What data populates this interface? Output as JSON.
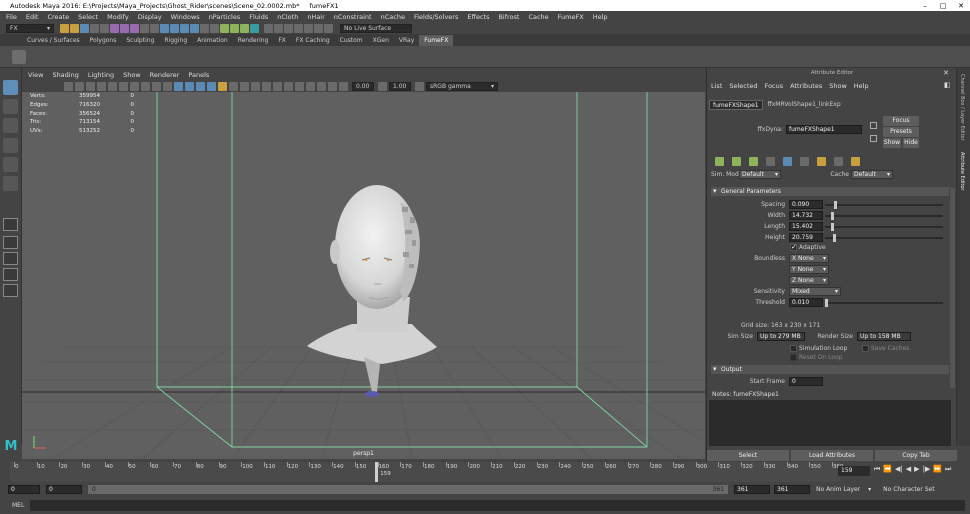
{
  "window": {
    "title": "Autodesk Maya 2016: E:\\Projects\\Maya_Projects\\Ghost_Rider\\scenes\\Scene_02.0002.mb*",
    "object": "fumeFX1",
    "controls": [
      "–",
      "□",
      "✕"
    ]
  },
  "menubar": [
    "File",
    "Edit",
    "Create",
    "Select",
    "Modify",
    "Display",
    "Windows",
    "nParticles",
    "Fluids",
    "nCloth",
    "nHair",
    "nConstraint",
    "nCache",
    "Fields/Solvers",
    "Effects",
    "Bifrost",
    "Cache",
    "FumeFX",
    "Help"
  ],
  "statusline": {
    "menuset": "FX",
    "live_surface": "No Live Surface"
  },
  "shelf_tabs": [
    "Curves / Surfaces",
    "Polygons",
    "Sculpting",
    "Rigging",
    "Animation",
    "Rendering",
    "FX",
    "FX Caching",
    "Custom",
    "XGen",
    "VRay",
    "FumeFX"
  ],
  "shelf_selected": "FumeFX",
  "viewport": {
    "menu": [
      "View",
      "Shading",
      "Lighting",
      "Show",
      "Renderer",
      "Panels"
    ],
    "exposure": "0.00",
    "gamma": "1.00",
    "color_space": "sRGB gamma",
    "camera": "persp1",
    "hud": [
      {
        "label": "Verts:",
        "v1": "359954",
        "v2": "0"
      },
      {
        "label": "Edges:",
        "v1": "716320",
        "v2": "0"
      },
      {
        "label": "Faces:",
        "v1": "356524",
        "v2": "0"
      },
      {
        "label": "Tris:",
        "v1": "713154",
        "v2": "0"
      },
      {
        "label": "UVs:",
        "v1": "513252",
        "v2": "0"
      }
    ]
  },
  "attribute_editor": {
    "panel_title": "Attribute Editor",
    "menu": [
      "List",
      "Selected",
      "Focus",
      "Attributes",
      "Show",
      "Help"
    ],
    "tabs": [
      "fumeFXShape1",
      "ffxMRVolShape1_linkExp"
    ],
    "node_label": "ffxDyna:",
    "node_value": "fumeFXShape1",
    "focus": "Focus",
    "presets": "Presets",
    "show": "Show",
    "hide": "Hide",
    "sim_mode_label": "Sim. Mode",
    "sim_mode": "Default",
    "cache_label": "Cache",
    "cache": "Default",
    "general_section": "General Parameters",
    "spacing_label": "Spacing",
    "spacing": "0.090",
    "spacing_frac": 0.08,
    "width_label": "Width",
    "width": "14.732",
    "width_frac": 0.05,
    "length_label": "Length",
    "length": "15.402",
    "length_frac": 0.05,
    "height_label": "Height",
    "height": "20.759",
    "height_frac": 0.07,
    "adaptive": "Adaptive",
    "boundless_label": "Boundless",
    "boundless_x": "X None",
    "boundless_y": "Y None",
    "boundless_z": "Z None",
    "sensitivity_label": "Sensitivity",
    "sensitivity": "Mixed",
    "threshold_label": "Threshold",
    "threshold": "0.010",
    "threshold_frac": 0.0,
    "grid_size": "Grid size: 163 x 230 x 171",
    "sim_size_label": "Sim Size",
    "sim_size": "Up to 279 MB",
    "render_size_label": "Render Size",
    "render_size": "Up to 158 MB",
    "simulation_loop": "Simulation Loop",
    "save_caches": "Save Caches",
    "reset_on_loop": "Reset On Loop",
    "output_section": "Output",
    "start_frame_label": "Start Frame",
    "start_frame": "0",
    "notes_label": "Notes: fumeFXShape1",
    "btn_select": "Select",
    "btn_load": "Load Attributes",
    "btn_copy": "Copy Tab"
  },
  "side_strip": [
    "Channel Box / Layer Editor",
    "Attribute Editor"
  ],
  "timeline": {
    "ticks": [
      "0",
      "10",
      "20",
      "30",
      "40",
      "50",
      "60",
      "70",
      "80",
      "90",
      "100",
      "110",
      "120",
      "130",
      "140",
      "150",
      "160",
      "170",
      "180",
      "190",
      "200",
      "210",
      "220",
      "230",
      "240",
      "250",
      "260",
      "270",
      "280",
      "290",
      "300",
      "310",
      "320",
      "330",
      "340",
      "350",
      "360"
    ],
    "playhead_label": "159",
    "playhead_frac": 0.4417,
    "current_frame": "159"
  },
  "range": {
    "start": "0",
    "range_start": "0",
    "range_inner": "0",
    "range_end_inner": "361",
    "range_end": "361",
    "end": "361",
    "anim_layer": "No Anim Layer",
    "char_set": "No Character Set"
  },
  "cmdline": {
    "label": "MEL"
  },
  "logo": "M"
}
